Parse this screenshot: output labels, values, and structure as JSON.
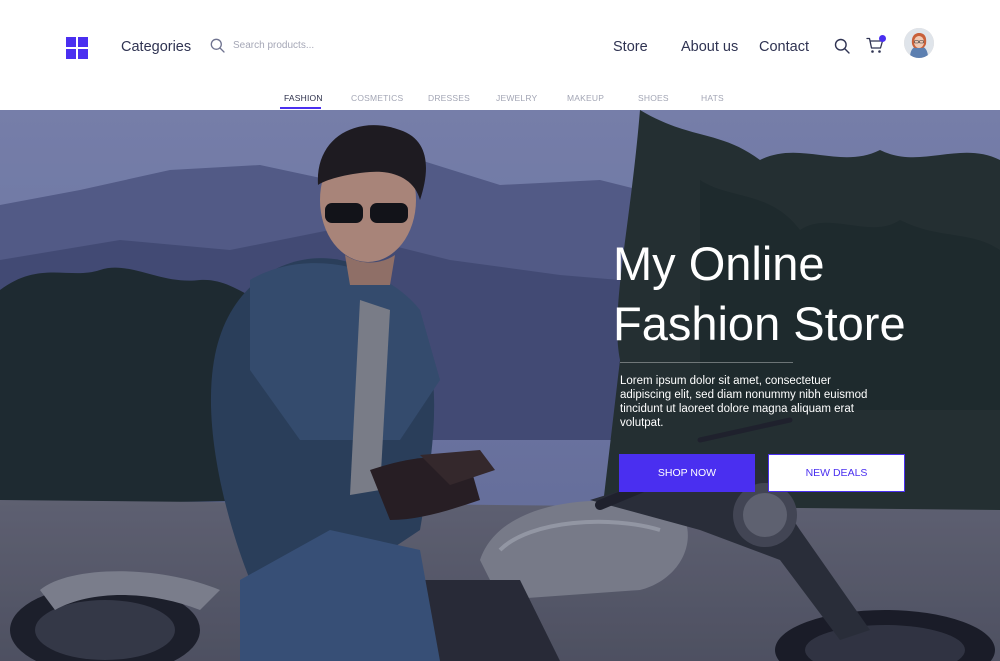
{
  "header": {
    "categories_label": "Categories",
    "search": {
      "placeholder": "Search products..."
    },
    "nav": {
      "store": "Store",
      "about": "About us",
      "contact": "Contact"
    },
    "cart_badge": true
  },
  "tabs": [
    {
      "label": "FASHION",
      "active": true
    },
    {
      "label": "COSMETICS",
      "active": false
    },
    {
      "label": "DRESSES",
      "active": false
    },
    {
      "label": "JEWELRY",
      "active": false
    },
    {
      "label": "MAKEUP",
      "active": false
    },
    {
      "label": "SHOES",
      "active": false
    },
    {
      "label": "HATS",
      "active": false
    }
  ],
  "hero": {
    "title": "My Online Fashion Store",
    "description": "Lorem ipsum dolor sit amet, consectetuer adipiscing elit, sed diam nonummy nibh euismod tincidunt ut laoreet dolore magna aliquam erat volutpat.",
    "primary_button": "SHOP NOW",
    "secondary_button": "NEW DEALS"
  },
  "colors": {
    "accent": "#4a2ff0",
    "text_dark": "#2f3352",
    "text_muted": "#a3a6b5"
  },
  "icons": {
    "logo": "grid-logo-icon",
    "search": "search-icon",
    "cart": "cart-icon",
    "avatar": "user-avatar"
  }
}
